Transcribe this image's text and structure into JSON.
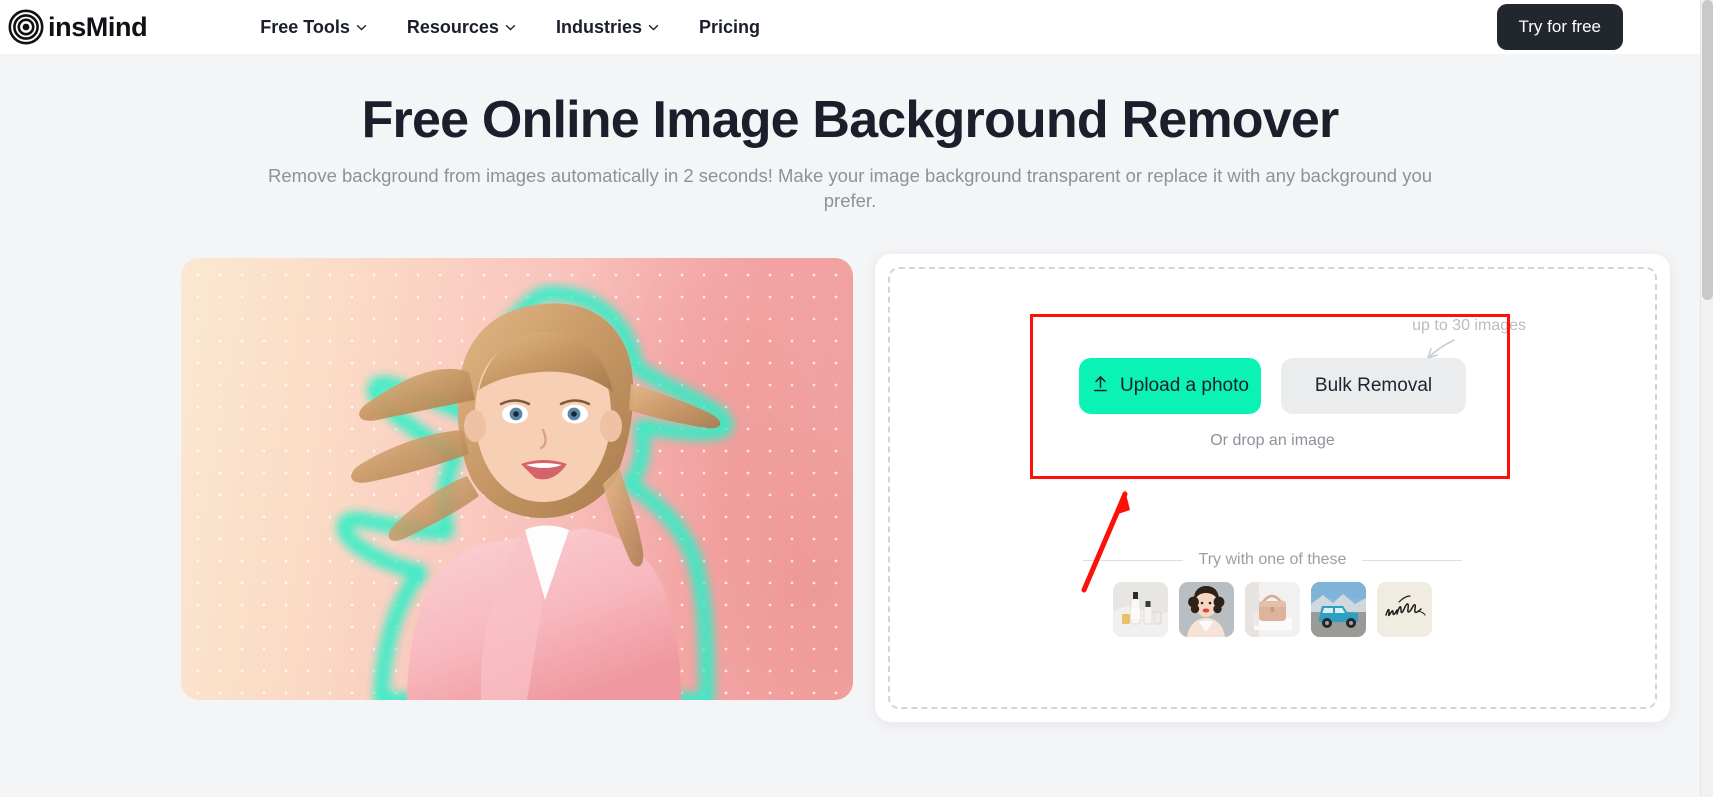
{
  "header": {
    "logo_text": "insMind",
    "logo_icon": "concentric-circles-logo-icon",
    "nav": [
      {
        "label": "Free Tools",
        "has_caret": true,
        "caret_icon": "chevron-down-icon"
      },
      {
        "label": "Resources",
        "has_caret": true,
        "caret_icon": "chevron-down-icon"
      },
      {
        "label": "Industries",
        "has_caret": true,
        "caret_icon": "chevron-down-icon"
      },
      {
        "label": "Pricing",
        "has_caret": false,
        "caret_icon": ""
      }
    ],
    "cta_label": "Try for free"
  },
  "hero": {
    "title": "Free Online Image Background Remover",
    "subtitle": "Remove background from images automatically in 2 seconds! Make your image background transparent or replace it with any background you prefer."
  },
  "preview": {
    "alt": "girl-with-cutout-glow-outline",
    "glow_color": "#2ef0c8",
    "bg_start": "#fbe8d2",
    "bg_end": "#efa09e"
  },
  "upload": {
    "upload_button_label": "Upload a photo",
    "upload_icon": "upload-arrow-icon",
    "bulk_button_label": "Bulk Removal",
    "bulk_badge": "up to 30 images",
    "badge_arrow_icon": "curved-arrow-icon",
    "drop_hint": "Or drop an image",
    "try_label": "Try with one of these",
    "samples": [
      {
        "name": "cosmetics-bottles-sample"
      },
      {
        "name": "woman-portrait-sample"
      },
      {
        "name": "beige-handbag-sample"
      },
      {
        "name": "blue-suv-truck-sample"
      },
      {
        "name": "insmind-signature-sample"
      }
    ],
    "accent_color": "#0bf3b4",
    "bulk_bg_color": "#ebecee"
  },
  "annotations": {
    "highlight_color": "#fc1008",
    "box_target": "upload-controls-area",
    "arrow_target": "upload-a-photo-button"
  }
}
